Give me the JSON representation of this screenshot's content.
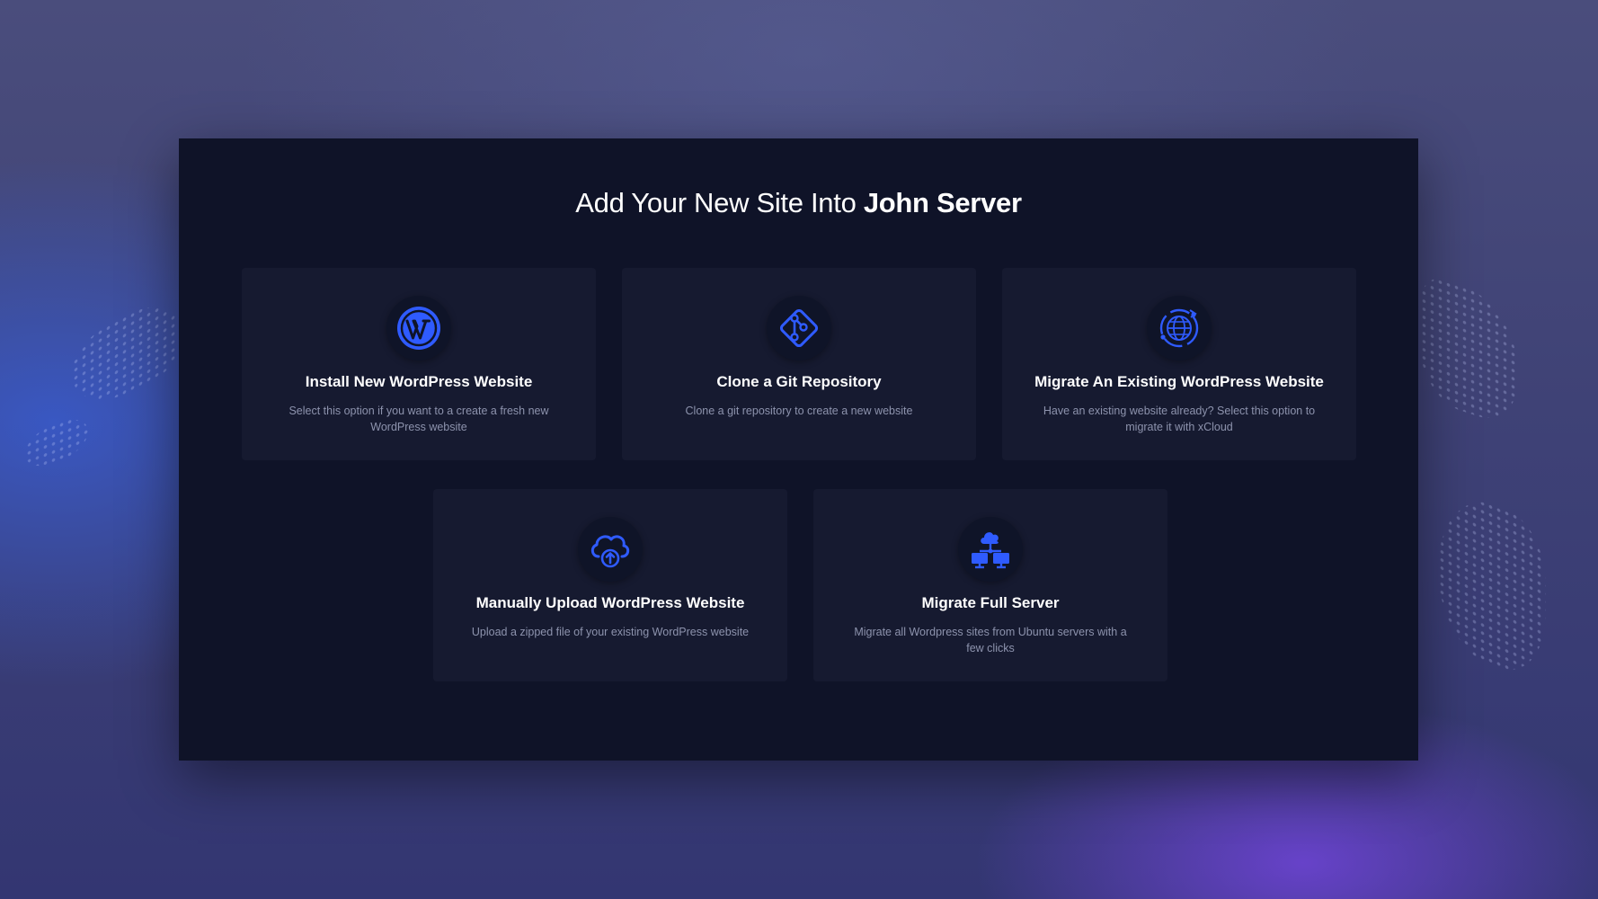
{
  "page": {
    "title_prefix": "Add Your New Site Into ",
    "server_name": "John Server"
  },
  "options": [
    {
      "icon": "wordpress-icon",
      "title": "Install New WordPress Website",
      "description": "Select this option if you want to a create a fresh new WordPress website"
    },
    {
      "icon": "git-icon",
      "title": "Clone a Git Repository",
      "description": "Clone a git repository to create a new website"
    },
    {
      "icon": "globe-migrate-icon",
      "title": "Migrate An Existing WordPress Website",
      "description": "Have an existing website already? Select this option to migrate it with xCloud"
    },
    {
      "icon": "cloud-upload-icon",
      "title": "Manually Upload WordPress Website",
      "description": "Upload a zipped file of your existing WordPress website"
    },
    {
      "icon": "server-network-icon",
      "title": "Migrate Full Server",
      "description": "Migrate all Wordpress sites from Ubuntu servers with a few clicks"
    }
  ],
  "colors": {
    "accent": "#2f5bff",
    "panel_bg": "#0f1328",
    "card_bg": "#161a30",
    "description_text": "#8d93ad"
  }
}
